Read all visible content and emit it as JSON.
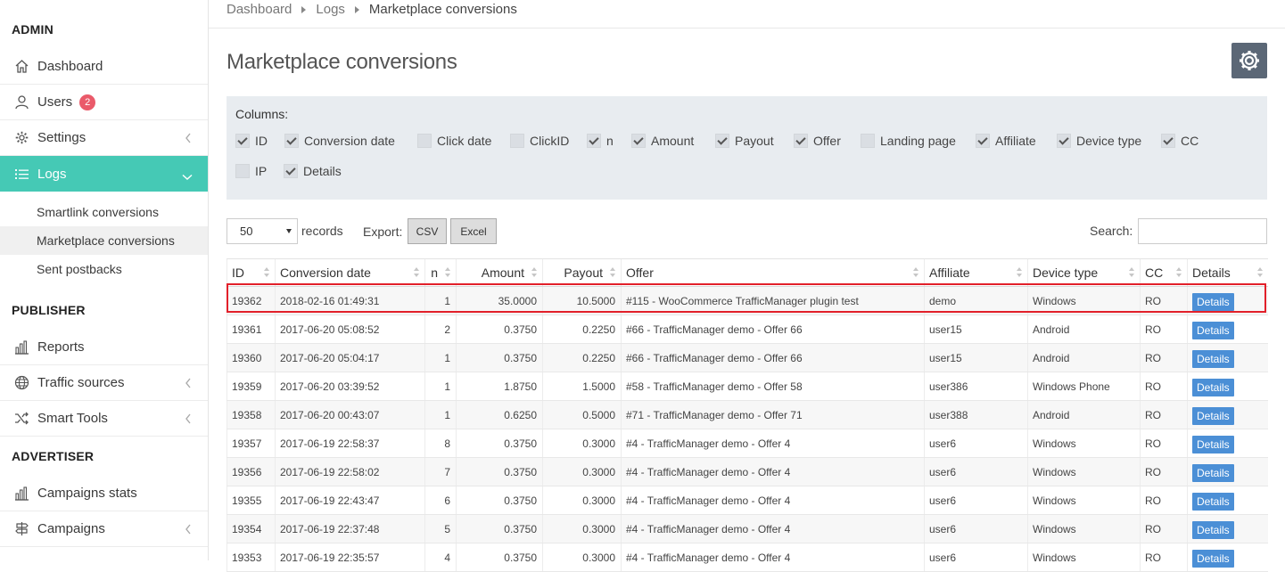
{
  "sidebar": {
    "sections": {
      "admin": "ADMIN",
      "publisher": "PUBLISHER",
      "advertiser": "ADVERTISER"
    },
    "items": {
      "dashboard": "Dashboard",
      "users": "Users",
      "users_badge": "2",
      "settings": "Settings",
      "logs": "Logs",
      "reports": "Reports",
      "traffic_sources": "Traffic sources",
      "smart_tools": "Smart Tools",
      "campaigns_stats": "Campaigns stats",
      "campaigns": "Campaigns"
    },
    "logs_sub": [
      "Smartlink conversions",
      "Marketplace conversions",
      "Sent postbacks"
    ],
    "accent": "#45c9b5"
  },
  "breadcrumb": [
    "Dashboard",
    "Logs",
    "Marketplace conversions"
  ],
  "page_title": "Marketplace conversions",
  "columns_panel": {
    "label": "Columns:",
    "options": [
      {
        "label": "ID",
        "checked": true
      },
      {
        "label": "Conversion date",
        "checked": true
      },
      {
        "label": "Click date",
        "checked": false
      },
      {
        "label": "ClickID",
        "checked": false
      },
      {
        "label": "n",
        "checked": true
      },
      {
        "label": "Amount",
        "checked": true
      },
      {
        "label": "Payout",
        "checked": true
      },
      {
        "label": "Offer",
        "checked": true
      },
      {
        "label": "Landing page",
        "checked": false
      },
      {
        "label": "Affiliate",
        "checked": true
      },
      {
        "label": "Device type",
        "checked": true
      },
      {
        "label": "CC",
        "checked": true
      },
      {
        "label": "IP",
        "checked": false
      },
      {
        "label": "Details",
        "checked": true
      }
    ]
  },
  "controls": {
    "records_value": "50",
    "records_label": "records",
    "export_label": "Export:",
    "csv_label": "CSV",
    "excel_label": "Excel",
    "search_label": "Search:",
    "search_value": ""
  },
  "table": {
    "headers": [
      "ID",
      "Conversion date",
      "n",
      "Amount",
      "Payout",
      "Offer",
      "Affiliate",
      "Device type",
      "CC",
      "Details"
    ],
    "details_label": "Details",
    "rows": [
      [
        "19362",
        "2018-02-16 01:49:31",
        "1",
        "35.0000",
        "10.5000",
        "#115 - WooCommerce TrafficManager plugin test",
        "demo",
        "Windows",
        "RO"
      ],
      [
        "19361",
        "2017-06-20 05:08:52",
        "2",
        "0.3750",
        "0.2250",
        "#66 - TrafficManager demo - Offer 66",
        "user15",
        "Android",
        "RO"
      ],
      [
        "19360",
        "2017-06-20 05:04:17",
        "1",
        "0.3750",
        "0.2250",
        "#66 - TrafficManager demo - Offer 66",
        "user15",
        "Android",
        "RO"
      ],
      [
        "19359",
        "2017-06-20 03:39:52",
        "1",
        "1.8750",
        "1.5000",
        "#58 - TrafficManager demo - Offer 58",
        "user386",
        "Windows Phone",
        "RO"
      ],
      [
        "19358",
        "2017-06-20 00:43:07",
        "1",
        "0.6250",
        "0.5000",
        "#71 - TrafficManager demo - Offer 71",
        "user388",
        "Android",
        "RO"
      ],
      [
        "19357",
        "2017-06-19 22:58:37",
        "8",
        "0.3750",
        "0.3000",
        "#4 - TrafficManager demo - Offer 4",
        "user6",
        "Windows",
        "RO"
      ],
      [
        "19356",
        "2017-06-19 22:58:02",
        "7",
        "0.3750",
        "0.3000",
        "#4 - TrafficManager demo - Offer 4",
        "user6",
        "Windows",
        "RO"
      ],
      [
        "19355",
        "2017-06-19 22:43:47",
        "6",
        "0.3750",
        "0.3000",
        "#4 - TrafficManager demo - Offer 4",
        "user6",
        "Windows",
        "RO"
      ],
      [
        "19354",
        "2017-06-19 22:37:48",
        "5",
        "0.3750",
        "0.3000",
        "#4 - TrafficManager demo - Offer 4",
        "user6",
        "Windows",
        "RO"
      ],
      [
        "19353",
        "2017-06-19 22:35:57",
        "4",
        "0.3750",
        "0.3000",
        "#4 - TrafficManager demo - Offer 4",
        "user6",
        "Windows",
        "RO"
      ]
    ]
  }
}
